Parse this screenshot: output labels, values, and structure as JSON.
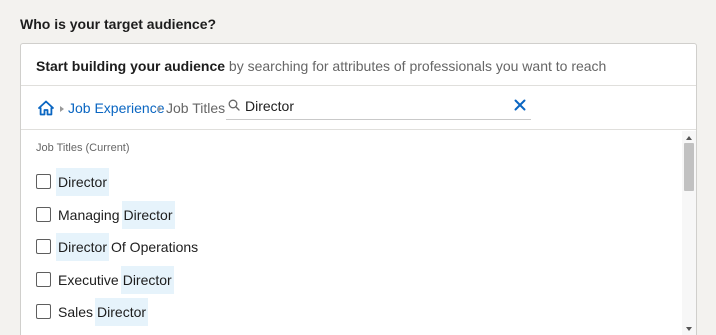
{
  "question": "Who is your target audience?",
  "intro": {
    "bold": "Start building your audience",
    "rest": " by searching for attributes of professionals you want to reach"
  },
  "breadcrumb": {
    "home_icon": "home-icon",
    "link": "Job Experience",
    "current": "Job Titles"
  },
  "search": {
    "value": "Director",
    "icons": {
      "search": "search-icon",
      "clear": "close-icon"
    }
  },
  "results": {
    "title": "Job Titles (Current)",
    "items": [
      {
        "pre": "",
        "match": "Director",
        "post": ""
      },
      {
        "pre": "Managing ",
        "match": "Director",
        "post": ""
      },
      {
        "pre": "",
        "match": "Director",
        "post": " Of Operations"
      },
      {
        "pre": "Executive ",
        "match": "Director",
        "post": ""
      },
      {
        "pre": "Sales ",
        "match": "Director",
        "post": ""
      }
    ]
  },
  "colors": {
    "link": "#0a66c2",
    "highlight": "#e6f3fb",
    "background": "#f3f2ef"
  }
}
